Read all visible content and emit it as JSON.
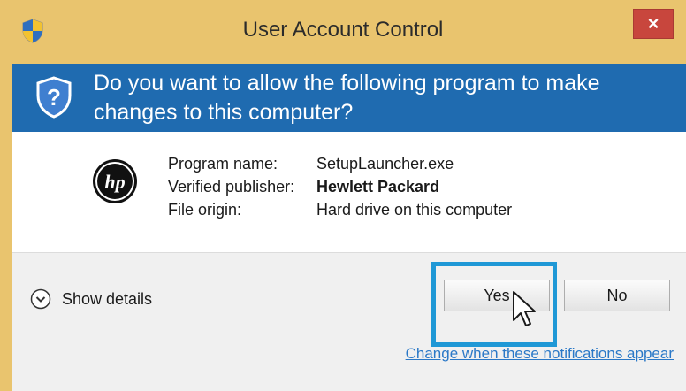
{
  "window": {
    "title": "User Account Control",
    "close_symbol": "×"
  },
  "header": {
    "question": "Do you want to allow the following program to make changes to this computer?",
    "icon": "shield-question-icon"
  },
  "program": {
    "logo_icon": "hp-logo-icon",
    "rows": [
      {
        "label": "Program name:",
        "value": "SetupLauncher.exe"
      },
      {
        "label": "Verified publisher:",
        "value": "Hewlett Packard"
      },
      {
        "label": "File origin:",
        "value": "Hard drive on this computer"
      }
    ]
  },
  "footer": {
    "show_details_label": "Show details",
    "yes_label": "Yes",
    "no_label": "No",
    "notifications_link": "Change when these notifications appear"
  },
  "colors": {
    "title_bar": "#e9c46e",
    "header_bg": "#1f6bb0",
    "close_bg": "#c8463d",
    "highlight": "#1f98d6",
    "link": "#2a78c7"
  }
}
